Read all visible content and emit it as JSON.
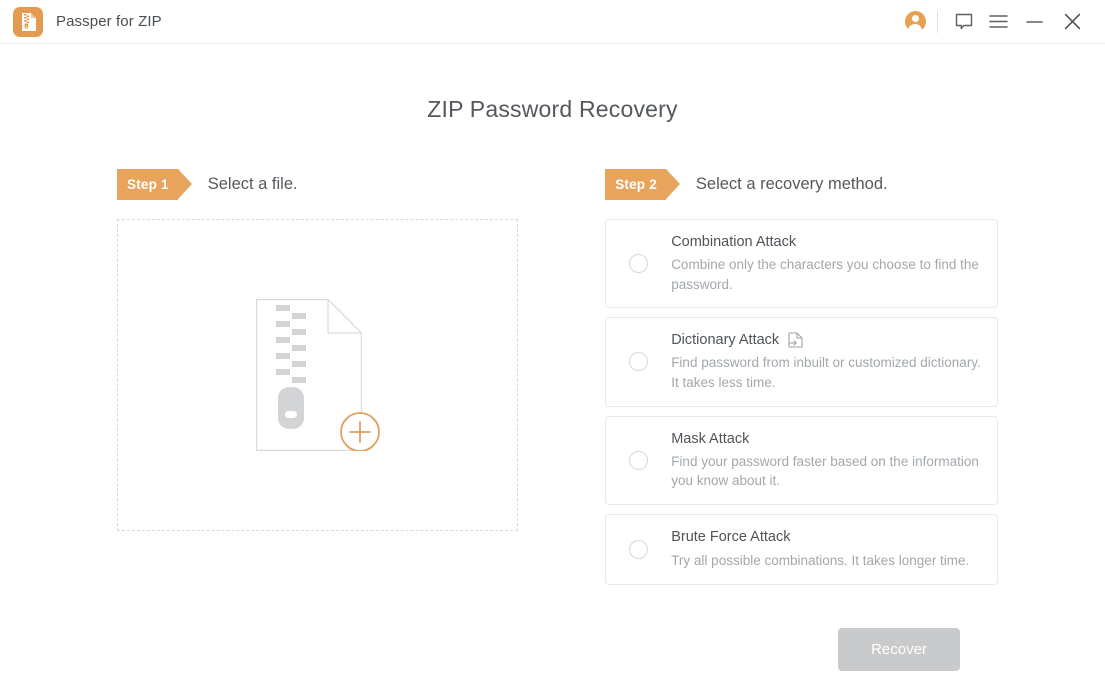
{
  "titlebar": {
    "app_name": "Passper for ZIP",
    "logo_icon": "zip-file-icon",
    "actions": [
      {
        "name": "account-button",
        "icon": "user-avatar-icon"
      },
      {
        "name": "feedback-button",
        "icon": "speech-bubble-icon"
      },
      {
        "name": "menu-button",
        "icon": "hamburger-menu-icon"
      },
      {
        "name": "minimize-button",
        "icon": "minimize-icon"
      },
      {
        "name": "close-button",
        "icon": "close-icon"
      }
    ]
  },
  "page": {
    "title": "ZIP Password Recovery"
  },
  "step1": {
    "badge": "Step 1",
    "label": "Select a file.",
    "dropzone_icon": "zip-document-add-icon",
    "add_icon": "plus-circle-icon"
  },
  "step2": {
    "badge": "Step 2",
    "label": "Select a recovery method.",
    "options": [
      {
        "title": "Combination Attack",
        "description": "Combine only the characters you choose to find the password.",
        "selected": false,
        "has_import_icon": false
      },
      {
        "title": "Dictionary Attack",
        "description": "Find password from inbuilt or customized dictionary. It takes less time.",
        "selected": false,
        "has_import_icon": true,
        "import_icon": "import-file-icon"
      },
      {
        "title": "Mask Attack",
        "description": "Find your password faster based on the information you know about it.",
        "selected": false,
        "has_import_icon": false
      },
      {
        "title": "Brute Force Attack",
        "description": "Try all possible combinations. It takes longer time.",
        "selected": false,
        "has_import_icon": false
      }
    ]
  },
  "footer": {
    "recover_label": "Recover",
    "recover_enabled": false
  },
  "colors": {
    "accent": "#e8a45c",
    "logo": "#e59a52",
    "text_primary": "#54585d",
    "text_muted": "#a3a8ad",
    "border": "#e7e9ea",
    "disabled_button": "#c8cacb"
  }
}
